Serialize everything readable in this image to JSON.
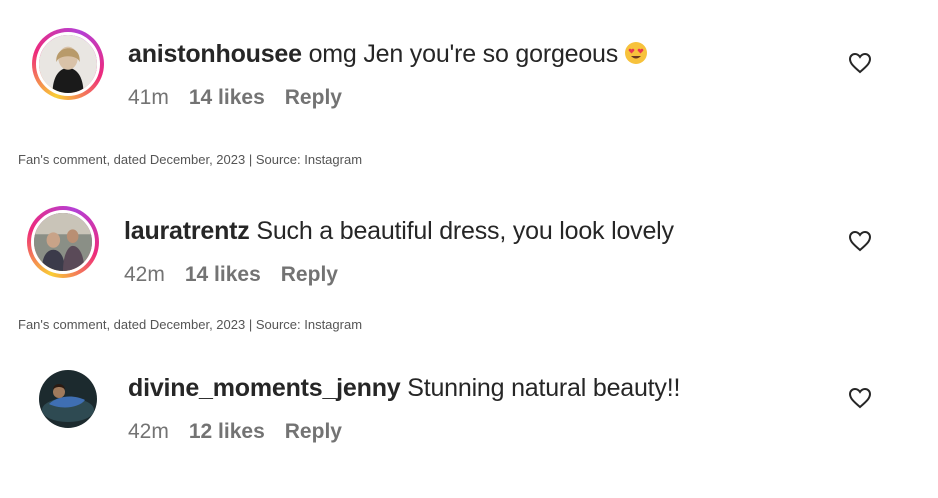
{
  "comments": [
    {
      "username": "anistonhousee",
      "text": "omg Jen you're so gorgeous",
      "emoji_icon": "heart-eyes-emoji",
      "time": "41m",
      "likes": "14 likes",
      "reply": "Reply"
    },
    {
      "username": "lauratrentz",
      "text": "Such a beautiful dress, you look lovely",
      "time": "42m",
      "likes": "14 likes",
      "reply": "Reply"
    },
    {
      "username": "divine_moments_jenny",
      "text": "Stunning natural beauty!!",
      "time": "42m",
      "likes": "12 likes",
      "reply": "Reply"
    }
  ],
  "captions": [
    "Fan's comment, dated December, 2023 | Source: Instagram",
    "Fan's comment, dated December, 2023 | Source: Instagram"
  ],
  "colors": {
    "story_ring": [
      "#f9ce34",
      "#ee2a7b",
      "#b43fd6"
    ],
    "text": "#262626",
    "meta": "#737373"
  }
}
